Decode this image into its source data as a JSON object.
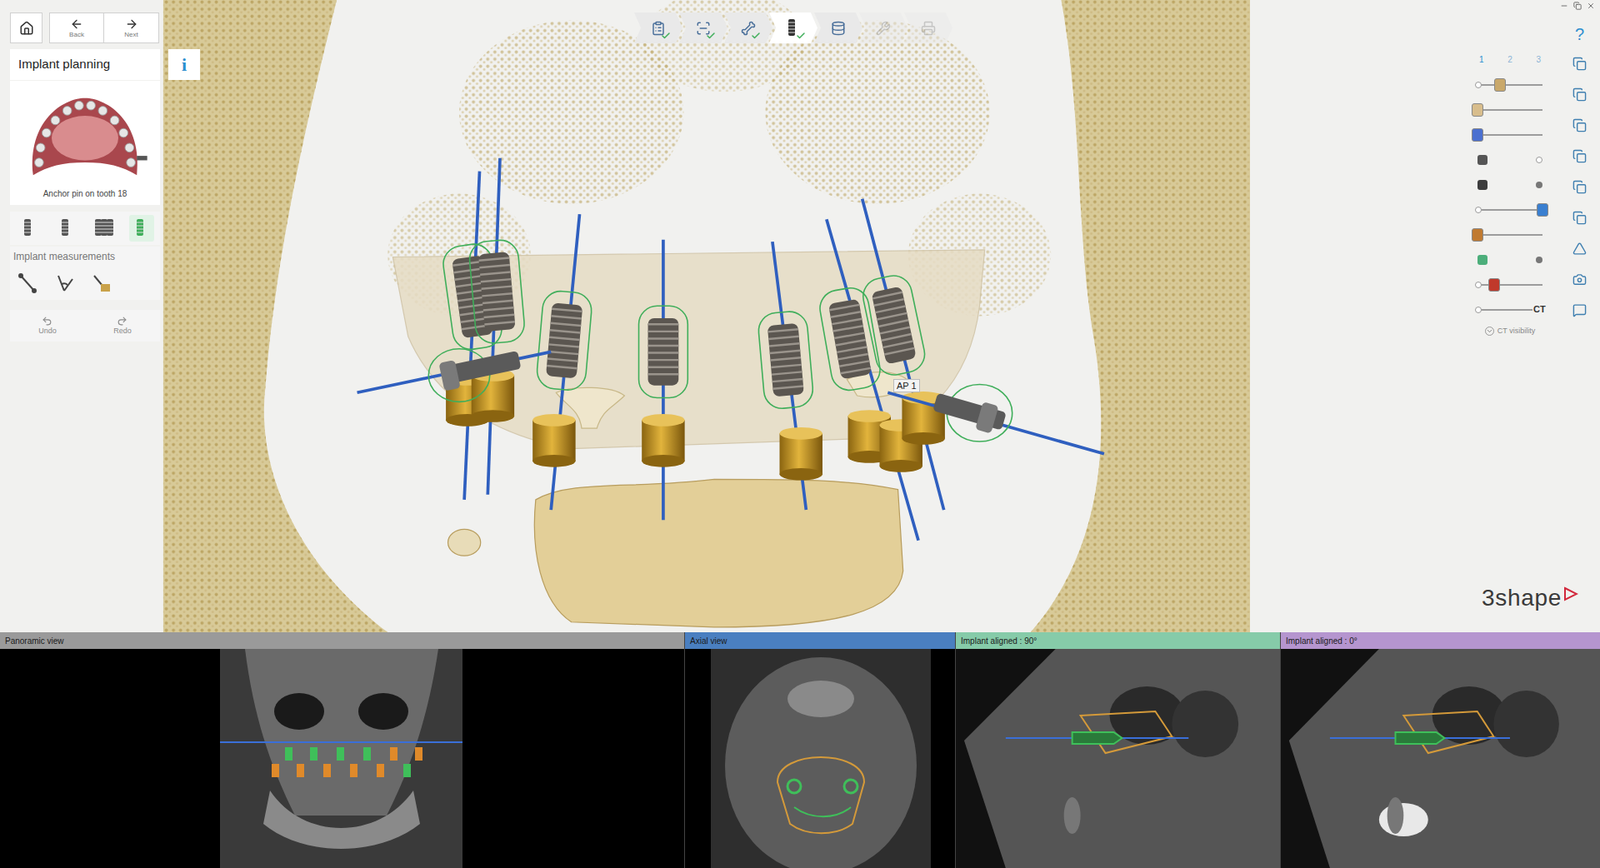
{
  "nav": {
    "back": "Back",
    "next": "Next"
  },
  "workflow": {
    "steps": [
      {
        "done": true,
        "selected": false,
        "disabled": false
      },
      {
        "done": true,
        "selected": false,
        "disabled": false
      },
      {
        "done": true,
        "selected": false,
        "disabled": false
      },
      {
        "done": true,
        "selected": true,
        "disabled": false
      },
      {
        "done": false,
        "selected": false,
        "disabled": false
      },
      {
        "done": false,
        "selected": false,
        "disabled": true
      },
      {
        "done": false,
        "selected": false,
        "disabled": true
      }
    ]
  },
  "left_panel": {
    "title": "Implant planning",
    "info": "i",
    "preview_caption": "Anchor pin on tooth 18",
    "tools": [
      {
        "selected": false
      },
      {
        "selected": false
      },
      {
        "selected": false
      },
      {
        "selected": true
      }
    ],
    "measurements_title": "Implant measurements",
    "measurement_tools": [
      {
        "kind": "distance"
      },
      {
        "kind": "angle"
      },
      {
        "kind": "density"
      }
    ],
    "undo": {
      "label": "Undo",
      "disabled": true
    },
    "redo": {
      "label": "Redo",
      "disabled": true
    }
  },
  "viewport": {
    "pin_label": "AP 1",
    "logo": "3shape"
  },
  "right_panel": {
    "help": "?",
    "tabs": [
      {
        "label": "1",
        "selected": true
      },
      {
        "label": "2",
        "selected": false
      },
      {
        "label": "3",
        "selected": false
      }
    ],
    "sliders": [
      {
        "kind": "slider",
        "level": 0.35
      },
      {
        "kind": "slider",
        "level": 0.0
      },
      {
        "kind": "slider",
        "level": 0.0
      },
      {
        "kind": "toggle",
        "on": false
      },
      {
        "kind": "toggle",
        "on": true
      },
      {
        "kind": "slider",
        "level": 1.0
      },
      {
        "kind": "slider",
        "level": 0.0
      },
      {
        "kind": "toggle",
        "on": true
      },
      {
        "kind": "slider",
        "level": 0.25
      },
      {
        "kind": "slider",
        "level": 1.0,
        "label": "CT"
      }
    ],
    "ct_visibility": "CT visibility"
  },
  "views": [
    {
      "title": "Panoramic view",
      "color": "#9a9a9a"
    },
    {
      "title": "Axial view",
      "color": "#4a7fc0"
    },
    {
      "title": "Implant aligned : 90°",
      "color": "#86cba9"
    },
    {
      "title": "Implant aligned : 0°",
      "color": "#b595cf"
    }
  ]
}
